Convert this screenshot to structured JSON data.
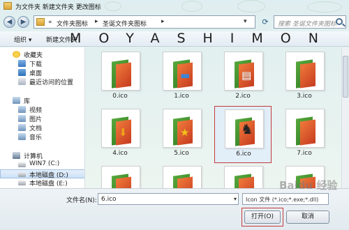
{
  "window": {
    "title": "为文件夹 新建文件夹 更改图标"
  },
  "address": {
    "path_prefix": "«",
    "path_items": [
      "文件夹图标",
      "圣诞文件夹图标"
    ],
    "separator": "▸",
    "refresh_icon": "refresh-icon",
    "search_placeholder": "搜索 圣诞文件夹图标"
  },
  "toolbar": {
    "organize_label": "组织 ▾",
    "new_folder_label": "新建文件夹",
    "watermark_text": "MOYASHIMON"
  },
  "sidebar": {
    "favorites_label": "收藏夹",
    "favorites": [
      "下载",
      "桌面",
      "最近访问的位置"
    ],
    "libraries_label": "库",
    "libraries": [
      "视频",
      "图片",
      "文档",
      "音乐"
    ],
    "computer_label": "计算机",
    "drives": [
      "WIN7 (C:)",
      "本地磁盘 (D:)",
      "本地磁盘 (E:)"
    ]
  },
  "files": [
    {
      "label": "0.ico",
      "overlay": "plain",
      "overlay_color": ""
    },
    {
      "label": "1.ico",
      "overlay": "screen",
      "overlay_color": "#3b86d6"
    },
    {
      "label": "2.ico",
      "overlay": "document",
      "overlay_color": "#ffffff"
    },
    {
      "label": "3.ico",
      "overlay": "plain-red",
      "overlay_color": "#c63b1f"
    },
    {
      "label": "4.ico",
      "overlay": "down-arrow",
      "overlay_color": "#f0a21a"
    },
    {
      "label": "5.ico",
      "overlay": "star",
      "overlay_color": "#f4c21c"
    },
    {
      "label": "6.ico",
      "overlay": "chess-piece",
      "overlay_color": "#222222"
    },
    {
      "label": "7.ico",
      "overlay": "plain-red",
      "overlay_color": "#c63b1f"
    },
    {
      "label": "",
      "overlay": "plain",
      "overlay_color": ""
    },
    {
      "label": "",
      "overlay": "plain",
      "overlay_color": ""
    },
    {
      "label": "",
      "overlay": "plain",
      "overlay_color": ""
    },
    {
      "label": "",
      "overlay": "plain",
      "overlay_color": ""
    }
  ],
  "selected_index": 6,
  "bottom": {
    "filename_label": "文件名(N):",
    "filename_value": "6.ico",
    "filetype_value": "Icon 文件 (*.ico;*.exe;*.dll)",
    "open_label": "打开(O)",
    "cancel_label": "取消"
  },
  "brand_watermark": "Baidu 经验"
}
